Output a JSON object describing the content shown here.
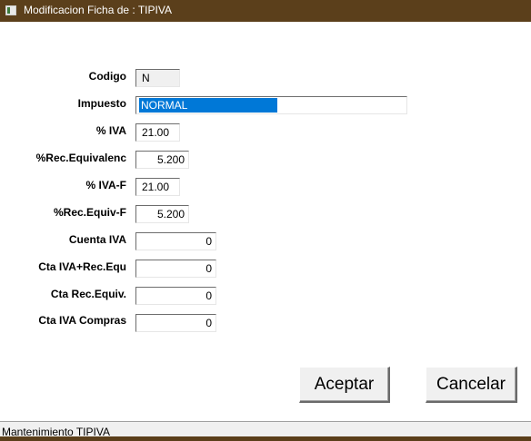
{
  "window": {
    "title": "Modificacion Ficha de : TIPIVA",
    "status": "Mantenimiento TIPIVA"
  },
  "form": {
    "codigo": {
      "label": "Codigo",
      "value": "N"
    },
    "impuesto": {
      "label": "Impuesto",
      "value": "NORMAL"
    },
    "iva": {
      "label": "% IVA",
      "value": "21.00"
    },
    "rec_equiv": {
      "label": "%Rec.Equivalenc",
      "value": "5.200"
    },
    "iva_f": {
      "label": "% IVA-F",
      "value": "21.00"
    },
    "rec_equiv_f": {
      "label": "%Rec.Equiv-F",
      "value": "5.200"
    },
    "cuenta_iva": {
      "label": "Cuenta IVA",
      "value": "0"
    },
    "cta_iva_rec": {
      "label": "Cta IVA+Rec.Equ",
      "value": "0"
    },
    "cta_rec": {
      "label": "Cta Rec.Equiv.",
      "value": "0"
    },
    "cta_compras": {
      "label": "Cta IVA Compras",
      "value": "0"
    }
  },
  "buttons": {
    "accept": "Aceptar",
    "cancel": "Cancelar"
  }
}
